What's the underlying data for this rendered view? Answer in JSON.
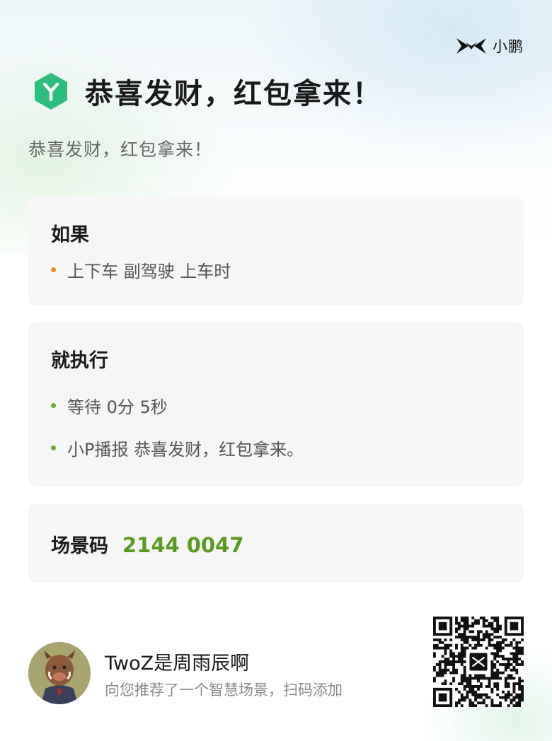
{
  "brand": {
    "name": "小鹏",
    "icon": "xpeng-logo-icon"
  },
  "header": {
    "icon": "hexagon-y-icon",
    "title": "恭喜发财，红包拿来！",
    "subtitle": "恭喜发财，红包拿来！"
  },
  "condition": {
    "label": "如果",
    "items": [
      "上下车 副驾驶 上车时"
    ]
  },
  "action": {
    "label": "就执行",
    "items": [
      "等待 0分 5秒",
      "小P播报 恭喜发财，红包拿来。"
    ]
  },
  "scene_code": {
    "label": "场景码",
    "value": "2144 0047"
  },
  "footer": {
    "user_name": "TwoZ是周雨辰啊",
    "description": "向您推荐了一个智慧场景，扫码添加",
    "qr_icon": "qr-code-icon"
  },
  "colors": {
    "accent_green": "#5a9a1e",
    "hex_icon": "#2dbd7e",
    "dot_orange": "#f08a24",
    "dot_green": "#6aab3a"
  }
}
